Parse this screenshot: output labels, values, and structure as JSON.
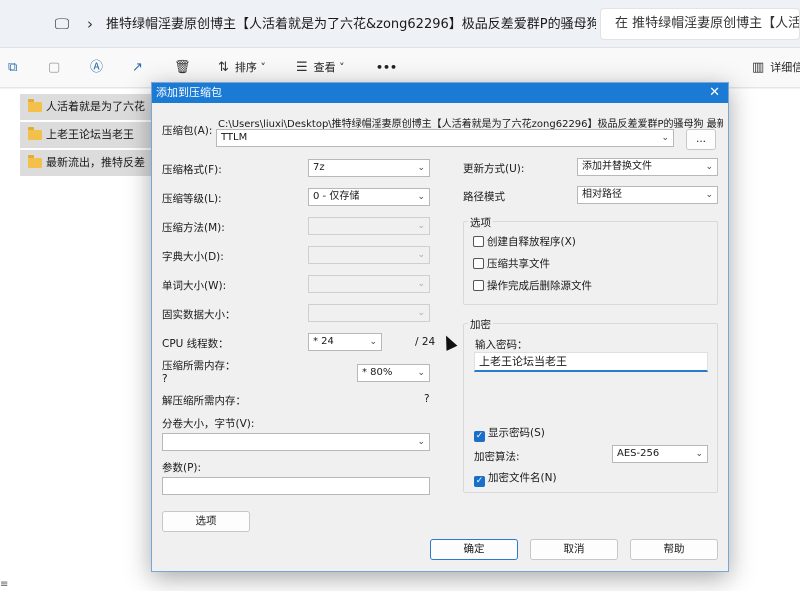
{
  "explorer": {
    "address": "推特绿帽淫妻原创博主【人活着就是为了六花&zong62296】极品反差爱群P的骚母狗 最",
    "search_placeholder": "在 推特绿帽淫妻原创博主【人活",
    "sort_label": "排序",
    "view_label": "查看",
    "more_label": "•••",
    "details_label": "详细信",
    "files": [
      "人活着就是为了六花",
      "上老王论坛当老王",
      "最新流出，推特反差"
    ],
    "status_icon": "≡"
  },
  "dialog": {
    "title": "添加到压缩包",
    "archive_label": "压缩包(A):",
    "archive_path": "C:\\Users\\liuxi\\Desktop\\推特绿帽淫妻原创博主【人活着就是为了六花zong62296】极品反差爱群P的骚母狗 最新",
    "archive_name": "TTLM",
    "browse_label": "...",
    "format_label": "压缩格式(F):",
    "format_value": "7z",
    "level_label": "压缩等级(L):",
    "level_value": "0 - 仅存储",
    "method_label": "压缩方法(M):",
    "dict_label": "字典大小(D):",
    "word_label": "单词大小(W):",
    "solid_label": "固实数据大小：",
    "cpu_label": "CPU 线程数：",
    "cpu_value": "* 24",
    "cpu_total": "/ 24",
    "mem_label": "压缩所需内存：",
    "mem_sub": "?",
    "mem_value": "* 80%",
    "demem_label": "解压缩所需内存：",
    "demem_value": "?",
    "split_label": "分卷大小，字节(V):",
    "params_label": "参数(P):",
    "options_button": "选项",
    "update_label": "更新方式(U):",
    "update_value": "添加并替换文件",
    "path_label": "路径模式",
    "path_value": "相对路径",
    "options_group": "选项",
    "opt_sfx": "创建自释放程序(X)",
    "opt_shared": "压缩共享文件",
    "opt_delete": "操作完成后删除源文件",
    "enc_group": "加密",
    "enc_pwd_label": "输入密码：",
    "enc_pwd_value": "上老王论坛当老王",
    "enc_show": "显示密码(S)",
    "enc_algo_label": "加密算法:",
    "enc_algo_value": "AES-256",
    "enc_names": "加密文件名(N)",
    "ok": "确定",
    "cancel": "取消",
    "help": "帮助"
  }
}
